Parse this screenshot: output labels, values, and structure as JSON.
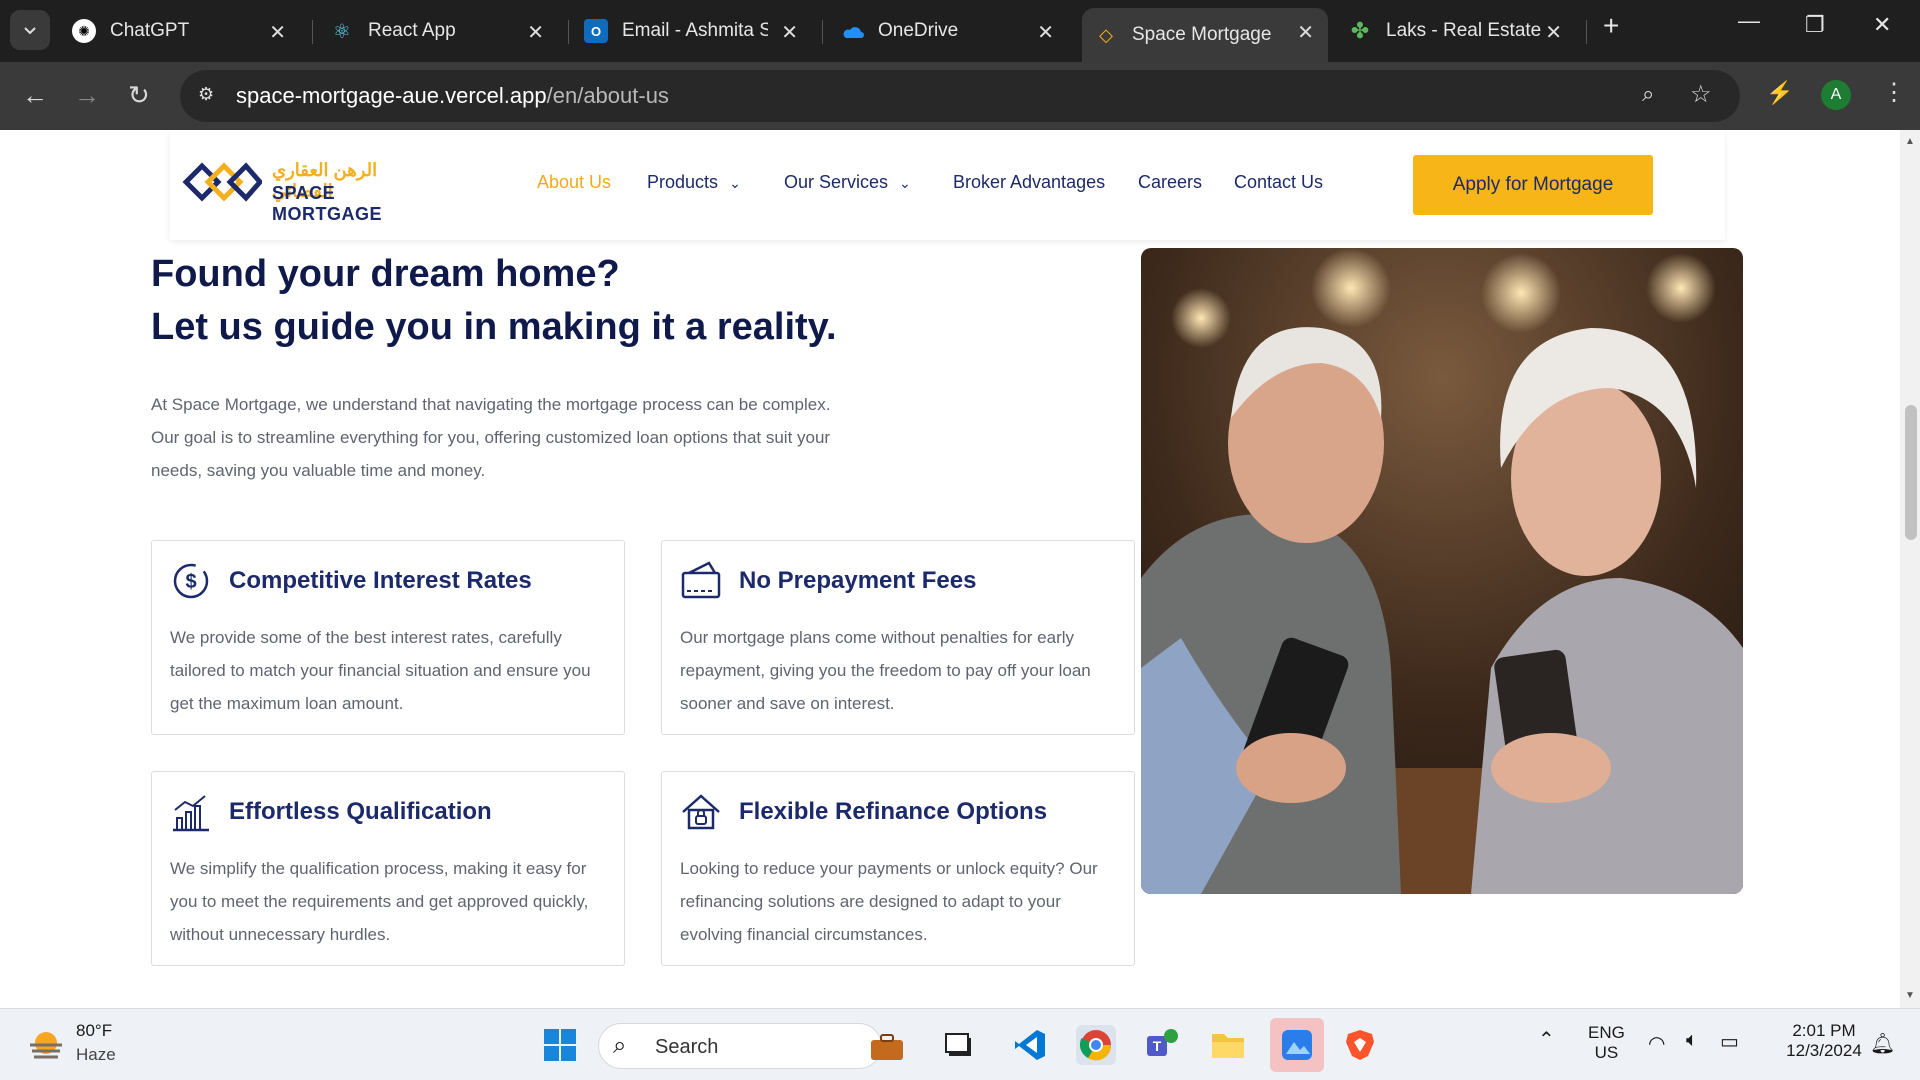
{
  "browser": {
    "tabs": [
      {
        "title": "ChatGPT"
      },
      {
        "title": "React App"
      },
      {
        "title": "Email - Ashmita Sh"
      },
      {
        "title": "OneDrive"
      },
      {
        "title": "Space Mortgage"
      },
      {
        "title": "Laks - Real Estate I"
      }
    ],
    "url_host": "space-mortgage-aue.vercel.app",
    "url_path": "/en/about-us",
    "profile_initial": "A"
  },
  "site": {
    "logo_ar": "الرهن العقاري الفضائي",
    "logo_en": "SPACE MORTGAGE",
    "nav": {
      "about": "About Us",
      "products": "Products",
      "services": "Our Services",
      "broker": "Broker Advantages",
      "careers": "Careers",
      "contact": "Contact Us"
    },
    "apply_label": "Apply for Mortgage",
    "hero": {
      "title_line1": "Found your dream home?",
      "title_line2": "Let us guide you in making it a reality.",
      "description": "At Space Mortgage, we understand that navigating the mortgage process can be complex. Our goal is to streamline everything for you, offering customized loan options that suit your needs, saving you valuable time and money."
    },
    "features": [
      {
        "title": "Competitive Interest Rates",
        "text": "We provide some of the best interest rates, carefully tailored to match your financial situation and ensure you get the maximum loan amount.",
        "icon": "dollar-cycle-icon"
      },
      {
        "title": "No Prepayment Fees",
        "text": "Our mortgage plans come without penalties for early repayment, giving you the freedom to pay off your loan sooner and save on interest.",
        "icon": "wallet-card-icon"
      },
      {
        "title": "Effortless Qualification",
        "text": "We simplify the qualification process, making it easy for you to meet the requirements and get approved quickly, without unnecessary hurdles.",
        "icon": "growth-chart-icon"
      },
      {
        "title": "Flexible Refinance Options",
        "text": "Looking to reduce your payments or unlock equity? Our refinancing solutions are designed to adapt to your evolving financial circumstances.",
        "icon": "house-refinance-icon"
      }
    ],
    "colors": {
      "navy": "#1c2a6b",
      "gold": "#f7b518"
    }
  },
  "taskbar": {
    "weather_temp": "80°F",
    "weather_desc": "Haze",
    "search_placeholder": "Search",
    "lang_line1": "ENG",
    "lang_line2": "US",
    "time": "2:01 PM",
    "date": "12/3/2024"
  }
}
